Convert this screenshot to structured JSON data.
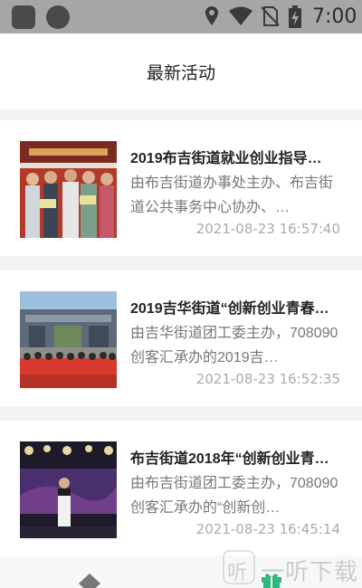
{
  "status_bar": {
    "time": "7:00",
    "icons": [
      "location-icon",
      "wifi-icon",
      "no-sim-icon",
      "battery-charging-icon"
    ]
  },
  "header": {
    "title": "最新活动"
  },
  "activities": [
    {
      "title": "2019布吉街道就业创业指导…",
      "description": "由布吉街道办事处主办、布吉街道公共事务中心协办、…",
      "time": "2021-08-23 16:57:40",
      "image_caption": "",
      "image_theme": "award-ceremony"
    },
    {
      "title": "2019吉华街道“创新创业青春…",
      "description": "由吉华街道团工委主办，708090创客汇承办的2019吉…",
      "time": "2021-08-23 16:52:35",
      "image_caption": "",
      "image_theme": "group-photo-outdoors"
    },
    {
      "title": "布吉街道2018年“创新创业青…",
      "description": "由布吉街道团工委主办，708090创客汇承办的“创新创…",
      "time": "2021-08-23 16:45:14",
      "image_caption": "",
      "image_theme": "stage-speech"
    }
  ],
  "tabbar": {
    "icons": [
      "home-icon",
      "gift-icon"
    ]
  },
  "watermark": {
    "badge": "听",
    "text": "一听下载"
  },
  "colors": {
    "status_bar": "#a6a6a6",
    "background": "#f2f2f2",
    "title": "#222222",
    "description": "#777777",
    "time": "#aaaaaa",
    "gift_green": "#2fb67a"
  }
}
